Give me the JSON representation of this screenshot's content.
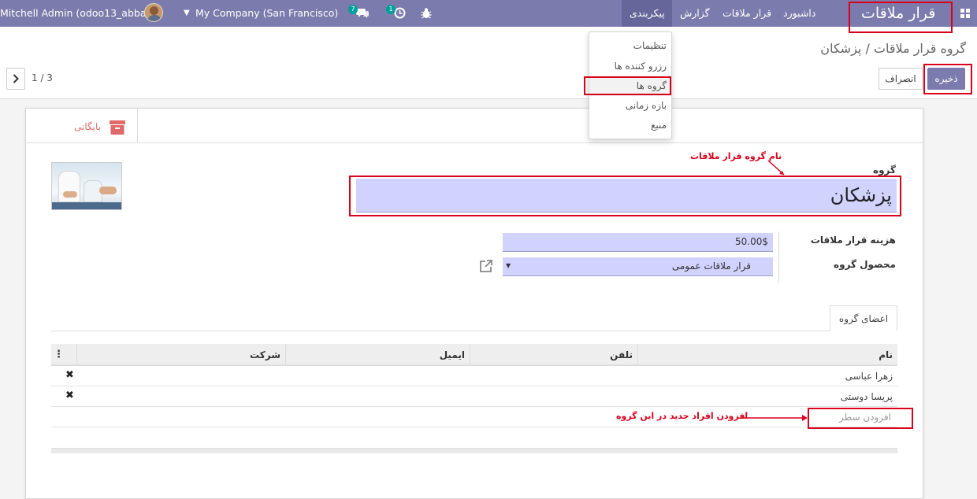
{
  "navbar": {
    "app_title": "قرار ملاقات",
    "menus": [
      "داشبورد",
      "قرار ملاقات",
      "گزارش",
      "پیکربندی"
    ],
    "company": "My Company (San Francisco)",
    "user": "Mitchell Admin (odoo13_abbasi)",
    "messages_count": "7",
    "activities_count": "1"
  },
  "dropdown": {
    "items": [
      "تنظیمات",
      "رزرو کننده ها",
      "گروه ها",
      "بازه زمانی",
      "منبع"
    ]
  },
  "control_panel": {
    "breadcrumb": "گروه قرار ملاقات / پزشکان",
    "save_label": "ذخیره",
    "discard_label": "انصراف",
    "pager": "1 / 3"
  },
  "form": {
    "archive_label": "بایگانی",
    "group_label": "گروه",
    "group_name": "پزشکان",
    "group_annotation": "نام گروه قرار ملاقات",
    "price_label": "هزینه قرار ملاقات",
    "price_value": "50.00$",
    "product_label": "محصول گروه",
    "product_value": "قرار ملاقات عمومی",
    "tab_label": "اعضای گروه",
    "columns": [
      "نام",
      "تلفن",
      "ایمیل",
      "شرکت"
    ],
    "rows": [
      {
        "name": "زهرا عباسی"
      },
      {
        "name": "پریسا دوستی"
      }
    ],
    "add_line": "افزودن سطر",
    "add_annotation": "افزودن افراد جدید در این گروه"
  },
  "colors": {
    "brand": "#7c7bad",
    "highlight": "#d9001b",
    "input_bg": "#d2d2ff"
  }
}
